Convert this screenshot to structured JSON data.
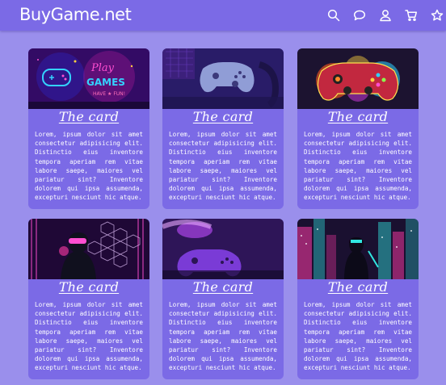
{
  "header": {
    "brand": "BuyGame.net",
    "icons": [
      "search-icon",
      "chat-icon",
      "user-icon",
      "cart-icon",
      "star-icon"
    ]
  },
  "cards": [
    {
      "title": "The card",
      "image": "neon-play-games-sign",
      "text": "Lorem, ipsum dolor sit amet consectetur adipisicing elit. Distinctio eius inventore tempora aperiam rem vitae labore saepe, maiores vel pariatur sint? Inventore dolorem qui ipsa assumenda, excepturi nesciunt hic atque."
    },
    {
      "title": "The card",
      "image": "gamepad-on-desk",
      "text": "Lorem, ipsum dolor sit amet consectetur adipisicing elit. Distinctio eius inventore tempora aperiam rem vitae labore saepe, maiores vel pariatur sint? Inventore dolorem qui ipsa assumenda, excepturi nesciunt hic atque."
    },
    {
      "title": "The card",
      "image": "colorful-splash-gamepad",
      "text": "Lorem, ipsum dolor sit amet consectetur adipisicing elit. Distinctio eius inventore tempora aperiam rem vitae labore saepe, maiores vel pariatur sint? Inventore dolorem qui ipsa assumenda, excepturi nesciunt hic atque."
    },
    {
      "title": "The card",
      "image": "vr-player-hexagons",
      "text": "Lorem, ipsum dolor sit amet consectetur adipisicing elit. Distinctio eius inventore tempora aperiam rem vitae labore saepe, maiores vel pariatur sint? Inventore dolorem qui ipsa assumenda, excepturi nesciunt hic atque."
    },
    {
      "title": "The card",
      "image": "purple-gamepad-headset",
      "text": "Lorem, ipsum dolor sit amet consectetur adipisicing elit. Distinctio eius inventore tempora aperiam rem vitae labore saepe, maiores vel pariatur sint? Inventore dolorem qui ipsa assumenda, excepturi nesciunt hic atque."
    },
    {
      "title": "The card",
      "image": "cyberpunk-city-warrior",
      "text": "Lorem, ipsum dolor sit amet consectetur adipisicing elit. Distinctio eius inventore tempora aperiam rem vitae labore saepe, maiores vel pariatur sint? Inventore dolorem qui ipsa assumenda, excepturi nesciunt hic atque."
    }
  ],
  "colors": {
    "page_bg": "#9a8fec",
    "header_bg": "#7b6ae6",
    "card_bg": "#7b6ae6",
    "text": "#ffffff"
  }
}
